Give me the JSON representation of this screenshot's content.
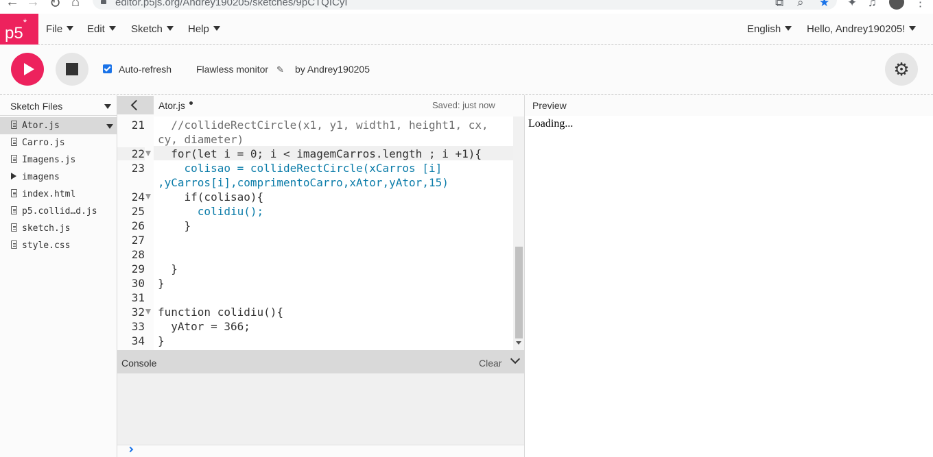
{
  "browser": {
    "url": "editor.p5js.org/Andrey190205/sketches/9pCTQICyI"
  },
  "menubar": {
    "logo": "p5",
    "logo_mark": "*",
    "items": [
      "File",
      "Edit",
      "Sketch",
      "Help"
    ],
    "language": "English",
    "greeting": "Hello, Andrey190205!"
  },
  "toolbar": {
    "autorefresh_label": "Auto-refresh",
    "autorefresh_checked": true,
    "sketch_name": "Flawless monitor",
    "author": "by Andrey190205"
  },
  "sidebar": {
    "title": "Sketch Files",
    "files": [
      {
        "name": "Ator.js",
        "type": "file",
        "active": true
      },
      {
        "name": "Carro.js",
        "type": "file"
      },
      {
        "name": "Imagens.js",
        "type": "file"
      },
      {
        "name": "imagens",
        "type": "folder"
      },
      {
        "name": "index.html",
        "type": "file"
      },
      {
        "name": "p5.collid…d.js",
        "type": "file"
      },
      {
        "name": "sketch.js",
        "type": "file"
      },
      {
        "name": "style.css",
        "type": "file"
      }
    ]
  },
  "editor": {
    "tab_name": "Ator.js",
    "saved_status": "Saved: just now",
    "line_numbers": [
      "21",
      "22",
      "23",
      "24",
      "25",
      "26",
      "27",
      "28",
      "29",
      "30",
      "31",
      "32",
      "33",
      "34"
    ],
    "code_lines": [
      "  //collideRectCircle(x1, y1, width1, height1, cx,",
      "cy, diameter)",
      "  for(let i = 0; i < imagemCarros.length ; i +1){",
      "    colisao = collideRectCircle(xCarros [i]",
      ",yCarros[i],comprimentoCarro,xAtor,yAtor,15)",
      "    if(colisao){",
      "      colidiu();",
      "    }",
      "",
      "",
      "  }",
      "}",
      "",
      "function colidiu(){",
      "  yAtor = 366;",
      "}"
    ]
  },
  "console": {
    "title": "Console",
    "clear_label": "Clear"
  },
  "preview": {
    "title": "Preview",
    "content": "Loading..."
  }
}
